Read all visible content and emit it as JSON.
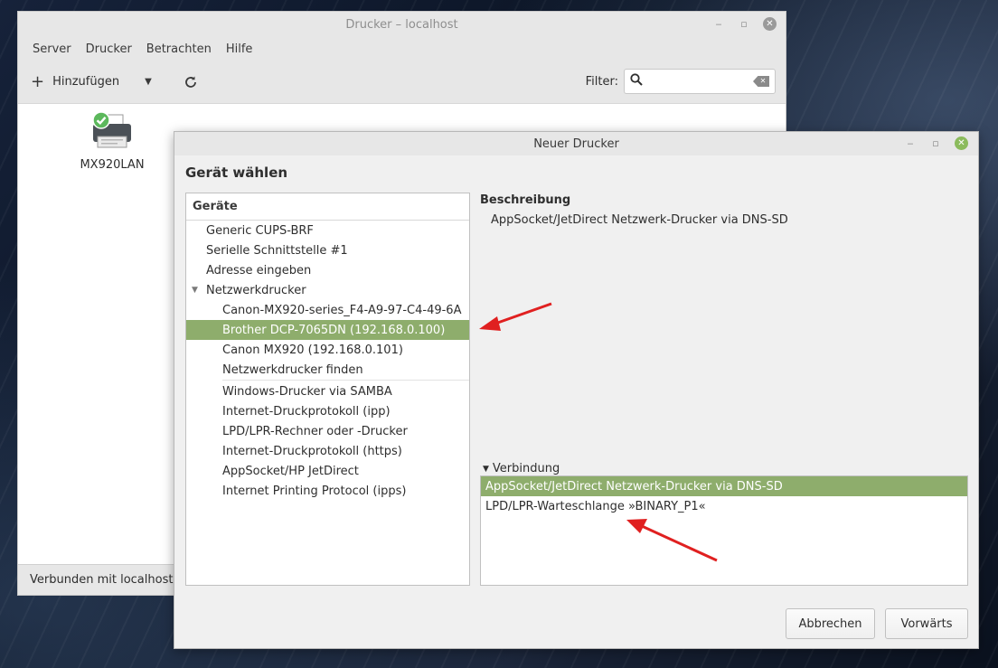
{
  "main_window": {
    "title": "Drucker – localhost",
    "menu": [
      "Server",
      "Drucker",
      "Betrachten",
      "Hilfe"
    ],
    "toolbar": {
      "add_label": "Hinzufügen",
      "filter_label": "Filter:",
      "filter_value": ""
    },
    "printers": [
      {
        "name": "MX920LAN"
      }
    ],
    "status": "Verbunden mit localhost"
  },
  "dialog": {
    "title": "Neuer Drucker",
    "heading": "Gerät wählen",
    "devices_header": "Geräte",
    "devices_top": [
      "Generic CUPS-BRF",
      "Serielle Schnittstelle #1",
      "Adresse eingeben"
    ],
    "network_group": "Netzwerkdrucker",
    "network_items": [
      "Canon-MX920-series_F4-A9-97-C4-49-6A",
      "Brother DCP-7065DN (192.168.0.100)",
      "Canon MX920 (192.168.0.101)",
      "Netzwerkdrucker finden"
    ],
    "other_items": [
      "Windows-Drucker via SAMBA",
      "Internet-Druckprotokoll (ipp)",
      "LPD/LPR-Rechner oder -Drucker",
      "Internet-Druckprotokoll (https)",
      "AppSocket/HP JetDirect",
      "Internet Printing Protocol (ipps)"
    ],
    "description_title": "Beschreibung",
    "description_text": "AppSocket/JetDirect Netzwerk-Drucker via DNS-SD",
    "connection_label": "Verbindung",
    "connections": [
      "AppSocket/JetDirect Netzwerk-Drucker via DNS-SD",
      "LPD/LPR-Warteschlange »BINARY_P1«"
    ],
    "cancel_label": "Abbrechen",
    "forward_label": "Vorwärts"
  },
  "colors": {
    "selection": "#8ead6c",
    "annotation_arrow": "#e02020",
    "status_ok": "#5cb85c"
  }
}
